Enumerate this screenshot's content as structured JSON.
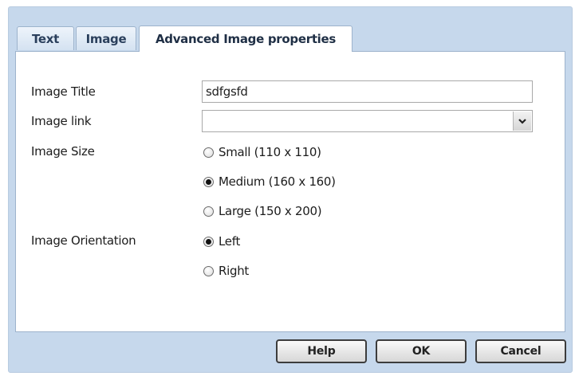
{
  "tabs": [
    "Text",
    "Image",
    "Advanced Image properties"
  ],
  "form": {
    "title_label": "Image Title",
    "title_value": "sdfgsfd",
    "link_label": "Image link",
    "link_value": "",
    "size_label": "Image Size",
    "size_options": [
      "Small (110 x 110)",
      "Medium (160 x 160)",
      "Large (150 x 200)"
    ],
    "size_selected": "Medium (160 x 160)",
    "orientation_label": "Image Orientation",
    "orientation_options": [
      "Left",
      "Right"
    ],
    "orientation_selected": "Left"
  },
  "buttons": {
    "help": "Help",
    "ok": "OK",
    "cancel": "Cancel"
  },
  "icons": {
    "dropdown": "chevron-down-icon"
  }
}
